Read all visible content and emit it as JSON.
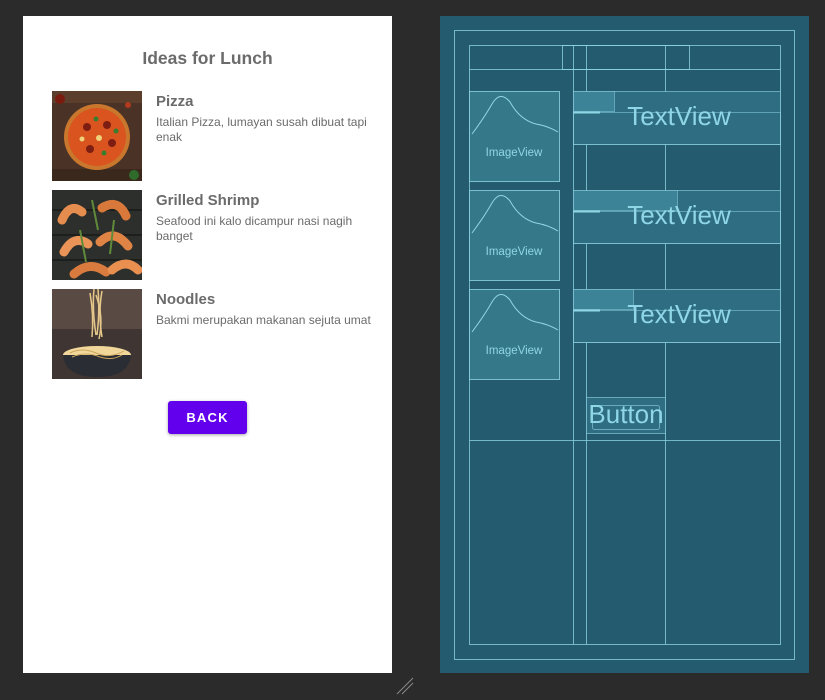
{
  "screen": {
    "title": "Ideas for Lunch",
    "foods": [
      {
        "name": "Pizza",
        "description": "Italian Pizza, lumayan susah dibuat tapi enak",
        "image_icon": "pizza-image"
      },
      {
        "name": "Grilled Shrimp",
        "description": "Seafood ini kalo dicampur nasi nagih banget",
        "image_icon": "shrimp-image"
      },
      {
        "name": "Noodles",
        "description": "Bakmi merupakan makanan sejuta umat",
        "image_icon": "noodles-image"
      }
    ],
    "back_label": "BACK",
    "accent_color": "#6200ee"
  },
  "blueprint": {
    "image_label": "ImageView",
    "text_label": "TextView",
    "button_label": "Button",
    "background_color": "#245b6e"
  }
}
